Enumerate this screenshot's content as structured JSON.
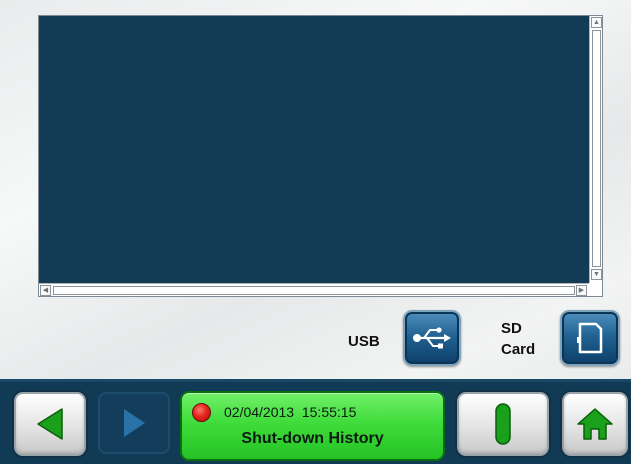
{
  "log": {
    "lines": [],
    "scroll_up_glyph": "▲",
    "scroll_down_glyph": "▼",
    "scroll_left_glyph": "◀",
    "scroll_right_glyph": "▶"
  },
  "export": {
    "usb_label": "USB",
    "sd_label_line1": "SD",
    "sd_label_line2": "Card",
    "usb_icon": "usb-icon",
    "sd_icon": "sd-card-icon"
  },
  "status": {
    "indicator_color": "#e5261c",
    "date": "02/04/2013",
    "time": "15:55:15",
    "title": "Shut-down History"
  },
  "nav": {
    "back_icon": "back-arrow-icon",
    "forward_icon": "forward-arrow-icon",
    "start_icon": "start-bar-icon",
    "home_icon": "home-icon"
  },
  "colors": {
    "panel_bg": "#133b55",
    "status_green": "#3fdc3b",
    "accent_blue": "#1f5f90",
    "icon_green": "#1aa01a"
  }
}
